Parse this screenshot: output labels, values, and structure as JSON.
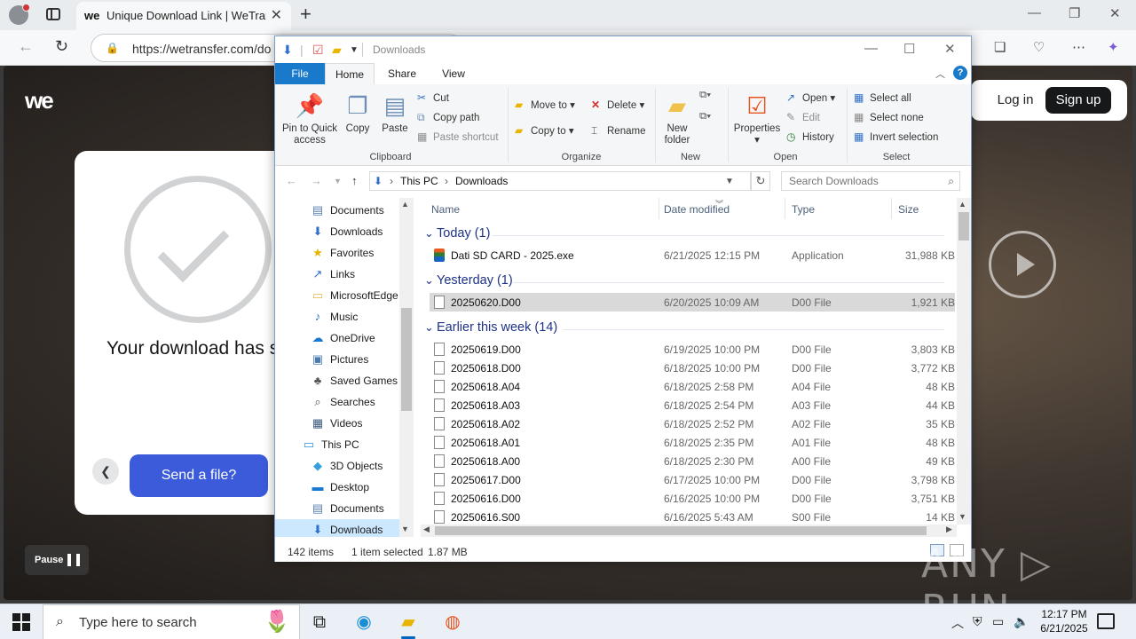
{
  "browser": {
    "tab_title": "Unique Download Link | WeTransfer",
    "tab_favicon": "we",
    "url": "https://wetransfer.com/do",
    "new_tab": "+",
    "close_tab": "✕"
  },
  "webpage": {
    "logo": "we",
    "login": "Log in",
    "signup": "Sign up",
    "download_message": "Your download has started",
    "send_button": "Send a file?",
    "pause_label": "Pause"
  },
  "explorer": {
    "title": "Downloads",
    "ribbon_tabs": [
      "File",
      "Home",
      "Share",
      "View"
    ],
    "clipboard": {
      "pin": "Pin to Quick access",
      "copy": "Copy",
      "paste": "Paste",
      "cut": "Cut",
      "copy_path": "Copy path",
      "paste_shortcut": "Paste shortcut",
      "group": "Clipboard"
    },
    "organize": {
      "move_to": "Move to",
      "copy_to": "Copy to",
      "delete": "Delete",
      "rename": "Rename",
      "group": "Organize"
    },
    "new": {
      "new_folder": "New folder",
      "group": "New"
    },
    "open": {
      "properties": "Properties",
      "open": "Open",
      "edit": "Edit",
      "history": "History",
      "group": "Open"
    },
    "select": {
      "select_all": "Select all",
      "select_none": "Select none",
      "invert": "Invert selection",
      "group": "Select"
    },
    "breadcrumb": [
      "This PC",
      "Downloads"
    ],
    "search_placeholder": "Search Downloads",
    "nav_items": [
      {
        "label": "Documents",
        "icon": "documents-icon",
        "glyph": "▤",
        "color": "#5b7fb5"
      },
      {
        "label": "Downloads",
        "icon": "downloads-icon",
        "glyph": "⬇",
        "color": "#2f6fc7"
      },
      {
        "label": "Favorites",
        "icon": "star-icon",
        "glyph": "★",
        "color": "#e8b400"
      },
      {
        "label": "Links",
        "icon": "links-icon",
        "glyph": "↗",
        "color": "#2f6fc7"
      },
      {
        "label": "MicrosoftEdge",
        "icon": "folder-icon",
        "glyph": "▭",
        "color": "#e6b84d"
      },
      {
        "label": "Music",
        "icon": "music-icon",
        "glyph": "♪",
        "color": "#2f6fc7"
      },
      {
        "label": "OneDrive",
        "icon": "cloud-icon",
        "glyph": "☁",
        "color": "#1a78d0"
      },
      {
        "label": "Pictures",
        "icon": "pictures-icon",
        "glyph": "▣",
        "color": "#4a7ab0"
      },
      {
        "label": "Saved Games",
        "icon": "saved-games-icon",
        "glyph": "♣",
        "color": "#555"
      },
      {
        "label": "Searches",
        "icon": "searches-icon",
        "glyph": "⌕",
        "color": "#555"
      },
      {
        "label": "Videos",
        "icon": "videos-icon",
        "glyph": "▦",
        "color": "#3d5a80"
      },
      {
        "label": "This PC",
        "icon": "computer-icon",
        "glyph": "▭",
        "color": "#2f8fd8"
      },
      {
        "label": "3D Objects",
        "icon": "cube-icon",
        "glyph": "◆",
        "color": "#37a0da"
      },
      {
        "label": "Desktop",
        "icon": "desktop-icon",
        "glyph": "▬",
        "color": "#1a78d0"
      },
      {
        "label": "Documents",
        "icon": "documents-icon",
        "glyph": "▤",
        "color": "#5b7fb5"
      },
      {
        "label": "Downloads",
        "icon": "downloads-icon",
        "glyph": "⬇",
        "color": "#2f6fc7"
      }
    ],
    "columns": {
      "name": "Name",
      "date": "Date modified",
      "type": "Type",
      "size": "Size"
    },
    "groups": [
      {
        "label": "Today (1)",
        "files": [
          {
            "name": "Dati SD CARD - 2025.exe",
            "date": "6/21/2025 12:15 PM",
            "type": "Application",
            "size": "31,988 KB",
            "exe": true
          }
        ]
      },
      {
        "label": "Yesterday (1)",
        "files": [
          {
            "name": "20250620.D00",
            "date": "6/20/2025 10:09 AM",
            "type": "D00 File",
            "size": "1,921 KB",
            "selected": true
          }
        ]
      },
      {
        "label": "Earlier this week (14)",
        "files": [
          {
            "name": "20250619.D00",
            "date": "6/19/2025 10:00 PM",
            "type": "D00 File",
            "size": "3,803 KB"
          },
          {
            "name": "20250618.D00",
            "date": "6/18/2025 10:00 PM",
            "type": "D00 File",
            "size": "3,772 KB"
          },
          {
            "name": "20250618.A04",
            "date": "6/18/2025 2:58 PM",
            "type": "A04 File",
            "size": "48 KB"
          },
          {
            "name": "20250618.A03",
            "date": "6/18/2025 2:54 PM",
            "type": "A03 File",
            "size": "44 KB"
          },
          {
            "name": "20250618.A02",
            "date": "6/18/2025 2:52 PM",
            "type": "A02 File",
            "size": "35 KB"
          },
          {
            "name": "20250618.A01",
            "date": "6/18/2025 2:35 PM",
            "type": "A01 File",
            "size": "48 KB"
          },
          {
            "name": "20250618.A00",
            "date": "6/18/2025 2:30 PM",
            "type": "A00 File",
            "size": "49 KB"
          },
          {
            "name": "20250617.D00",
            "date": "6/17/2025 10:00 PM",
            "type": "D00 File",
            "size": "3,798 KB"
          },
          {
            "name": "20250616.D00",
            "date": "6/16/2025 10:00 PM",
            "type": "D00 File",
            "size": "3,751 KB"
          },
          {
            "name": "20250616.S00",
            "date": "6/16/2025 5:43 AM",
            "type": "S00 File",
            "size": "14 KB"
          }
        ]
      }
    ],
    "status": {
      "items": "142 items",
      "selected": "1 item selected",
      "size": "1.87 MB"
    }
  },
  "watermark": "ANY ▷ RUN",
  "taskbar": {
    "search_placeholder": "Type here to search",
    "time": "12:17 PM",
    "date": "6/21/2025"
  }
}
